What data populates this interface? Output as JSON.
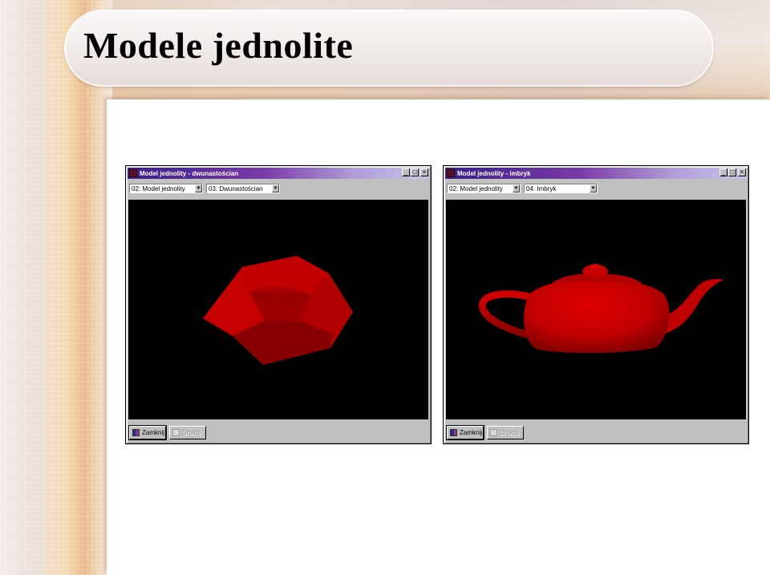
{
  "slide": {
    "title": "Modele jednolite"
  },
  "windows": [
    {
      "title": "Model jednolity - dwunastościan",
      "model_select": "02: Model jednolity",
      "object_select": "03. Dwunastościan",
      "close_button": "Zamknij",
      "print_button": "Drukuj",
      "object": "dodecahedron"
    },
    {
      "title": "Model jednolity - imbryk",
      "model_select": "02: Model jednolity",
      "object_select": "04. Imbryk",
      "close_button": "Zamknij",
      "print_button": "Drukuj",
      "object": "teapot"
    }
  ],
  "colors": {
    "title_gradient_start": "#3a1f86",
    "title_gradient_end": "#c8c4ec",
    "model_red": "#cc0000",
    "viewport_bg": "#000000"
  }
}
